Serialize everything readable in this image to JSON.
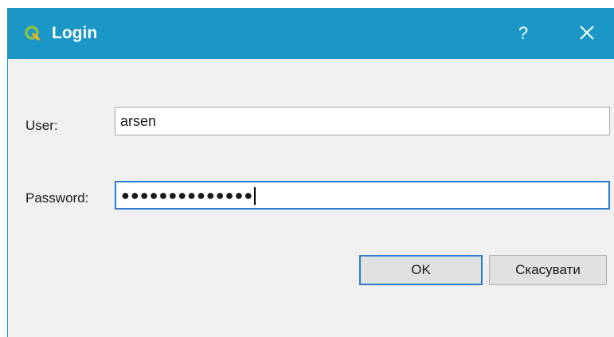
{
  "window": {
    "title": "Login",
    "app_icon": "qgis-logo-icon",
    "help_label": "?",
    "close_icon": "close-icon",
    "titlebar_color": "#1a97c6"
  },
  "form": {
    "user_label": "User:",
    "user_value": "arsen",
    "password_label": "Password:",
    "password_value": "●●●●●●●●●●●●●●"
  },
  "buttons": {
    "ok_label": "OK",
    "cancel_label": "Скасувати"
  }
}
